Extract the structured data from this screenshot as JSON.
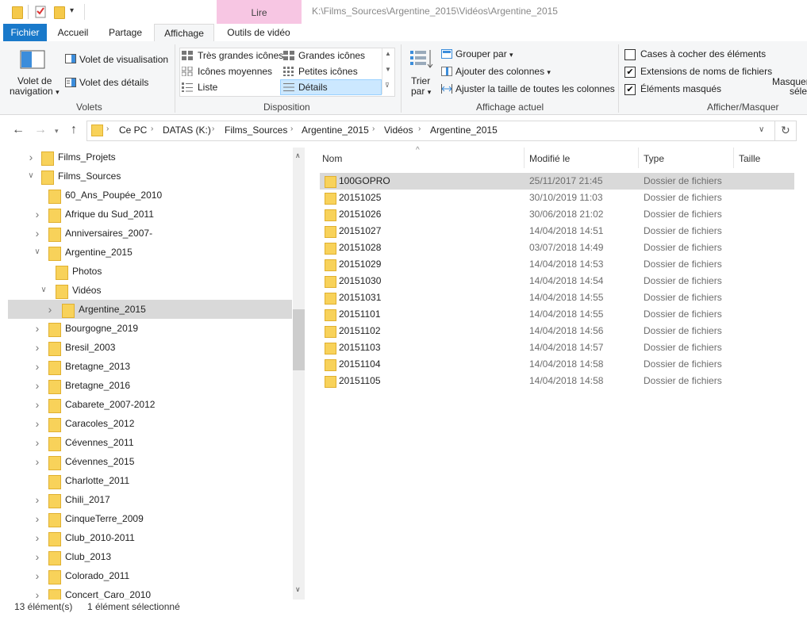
{
  "window": {
    "title": "K:\\Films_Sources\\Argentine_2015\\Vidéos\\Argentine_2015",
    "context_tab": "Lire"
  },
  "tabs": [
    "Fichier",
    "Accueil",
    "Partage",
    "Affichage",
    "Outils de vidéo"
  ],
  "ribbon": {
    "volets": {
      "nav_pane_line1": "Volet de",
      "nav_pane_line2": "navigation",
      "preview_pane": "Volet de visualisation",
      "details_pane": "Volet des détails",
      "label": "Volets"
    },
    "disposition": {
      "items": [
        "Très grandes icônes",
        "Grandes icônes",
        "Icônes moyennes",
        "Petites icônes",
        "Liste",
        "Détails"
      ],
      "selected": "Détails",
      "label": "Disposition"
    },
    "affichage_actuel": {
      "sort_line1": "Trier",
      "sort_line2": "par",
      "group_by": "Grouper par",
      "add_columns": "Ajouter des colonnes",
      "fit_columns": "Ajuster la taille de toutes les colonnes",
      "label": "Affichage actuel"
    },
    "afficher_masquer": {
      "checkboxes": [
        {
          "label": "Cases à cocher des éléments",
          "checked": false
        },
        {
          "label": "Extensions de noms de fichiers",
          "checked": true
        },
        {
          "label": "Éléments masqués",
          "checked": true
        }
      ],
      "hide_line1": "Masquer",
      "hide_line2": "séle",
      "label": "Afficher/Masquer"
    }
  },
  "breadcrumb": [
    "Ce PC",
    "DATAS (K:)",
    "Films_Sources",
    "Argentine_2015",
    "Vidéos",
    "Argentine_2015"
  ],
  "tree": [
    {
      "label": "Films_Projets",
      "expander": "collapsed",
      "level": 0
    },
    {
      "label": "Films_Sources",
      "expander": "expanded",
      "level": 0
    },
    {
      "label": "60_Ans_Poupée_2010",
      "expander": "none",
      "level": 1
    },
    {
      "label": "Afrique du Sud_2011",
      "expander": "collapsed",
      "level": 1
    },
    {
      "label": "Anniversaires_2007-",
      "expander": "collapsed",
      "level": 1
    },
    {
      "label": "Argentine_2015",
      "expander": "expanded",
      "level": 1
    },
    {
      "label": "Photos",
      "expander": "none",
      "level": 2
    },
    {
      "label": "Vidéos",
      "expander": "expanded",
      "level": 2
    },
    {
      "label": "Argentine_2015",
      "expander": "collapsed",
      "level": 3,
      "selected": true
    },
    {
      "label": "Bourgogne_2019",
      "expander": "collapsed",
      "level": 1
    },
    {
      "label": "Bresil_2003",
      "expander": "collapsed",
      "level": 1
    },
    {
      "label": "Bretagne_2013",
      "expander": "collapsed",
      "level": 1
    },
    {
      "label": "Bretagne_2016",
      "expander": "collapsed",
      "level": 1
    },
    {
      "label": "Cabarete_2007-2012",
      "expander": "collapsed",
      "level": 1
    },
    {
      "label": "Caracoles_2012",
      "expander": "collapsed",
      "level": 1
    },
    {
      "label": "Cévennes_2011",
      "expander": "collapsed",
      "level": 1
    },
    {
      "label": "Cévennes_2015",
      "expander": "collapsed",
      "level": 1
    },
    {
      "label": "Charlotte_2011",
      "expander": "none",
      "level": 1
    },
    {
      "label": "Chili_2017",
      "expander": "collapsed",
      "level": 1
    },
    {
      "label": "CinqueTerre_2009",
      "expander": "collapsed",
      "level": 1
    },
    {
      "label": "Club_2010-2011",
      "expander": "collapsed",
      "level": 1
    },
    {
      "label": "Club_2013",
      "expander": "collapsed",
      "level": 1
    },
    {
      "label": "Colorado_2011",
      "expander": "collapsed",
      "level": 1
    },
    {
      "label": "Concert_Caro_2010",
      "expander": "collapsed",
      "level": 1
    }
  ],
  "columns": [
    "Nom",
    "Modifié le",
    "Type",
    "Taille"
  ],
  "files": [
    {
      "name": "100GOPRO",
      "modified": "25/11/2017 21:45",
      "type": "Dossier de fichiers",
      "selected": true
    },
    {
      "name": "20151025",
      "modified": "30/10/2019 11:03",
      "type": "Dossier de fichiers"
    },
    {
      "name": "20151026",
      "modified": "30/06/2018 21:02",
      "type": "Dossier de fichiers"
    },
    {
      "name": "20151027",
      "modified": "14/04/2018 14:51",
      "type": "Dossier de fichiers"
    },
    {
      "name": "20151028",
      "modified": "03/07/2018 14:49",
      "type": "Dossier de fichiers"
    },
    {
      "name": "20151029",
      "modified": "14/04/2018 14:53",
      "type": "Dossier de fichiers"
    },
    {
      "name": "20151030",
      "modified": "14/04/2018 14:54",
      "type": "Dossier de fichiers"
    },
    {
      "name": "20151031",
      "modified": "14/04/2018 14:55",
      "type": "Dossier de fichiers"
    },
    {
      "name": "20151101",
      "modified": "14/04/2018 14:55",
      "type": "Dossier de fichiers"
    },
    {
      "name": "20151102",
      "modified": "14/04/2018 14:56",
      "type": "Dossier de fichiers"
    },
    {
      "name": "20151103",
      "modified": "14/04/2018 14:57",
      "type": "Dossier de fichiers"
    },
    {
      "name": "20151104",
      "modified": "14/04/2018 14:58",
      "type": "Dossier de fichiers"
    },
    {
      "name": "20151105",
      "modified": "14/04/2018 14:58",
      "type": "Dossier de fichiers"
    }
  ],
  "status": {
    "count": "13 élément(s)",
    "selection": "1 élément sélectionné"
  },
  "colors": {
    "accent": "#1979ca",
    "context_tab": "#f7c6e3",
    "folder": "#f8d25a",
    "selection": "#d9d9d9"
  },
  "icons": [
    "folder-icon",
    "properties-icon",
    "dropdown-arrow-icon",
    "back-arrow-icon",
    "forward-arrow-icon",
    "up-arrow-icon",
    "refresh-icon",
    "chevron-icon",
    "check-icon"
  ]
}
